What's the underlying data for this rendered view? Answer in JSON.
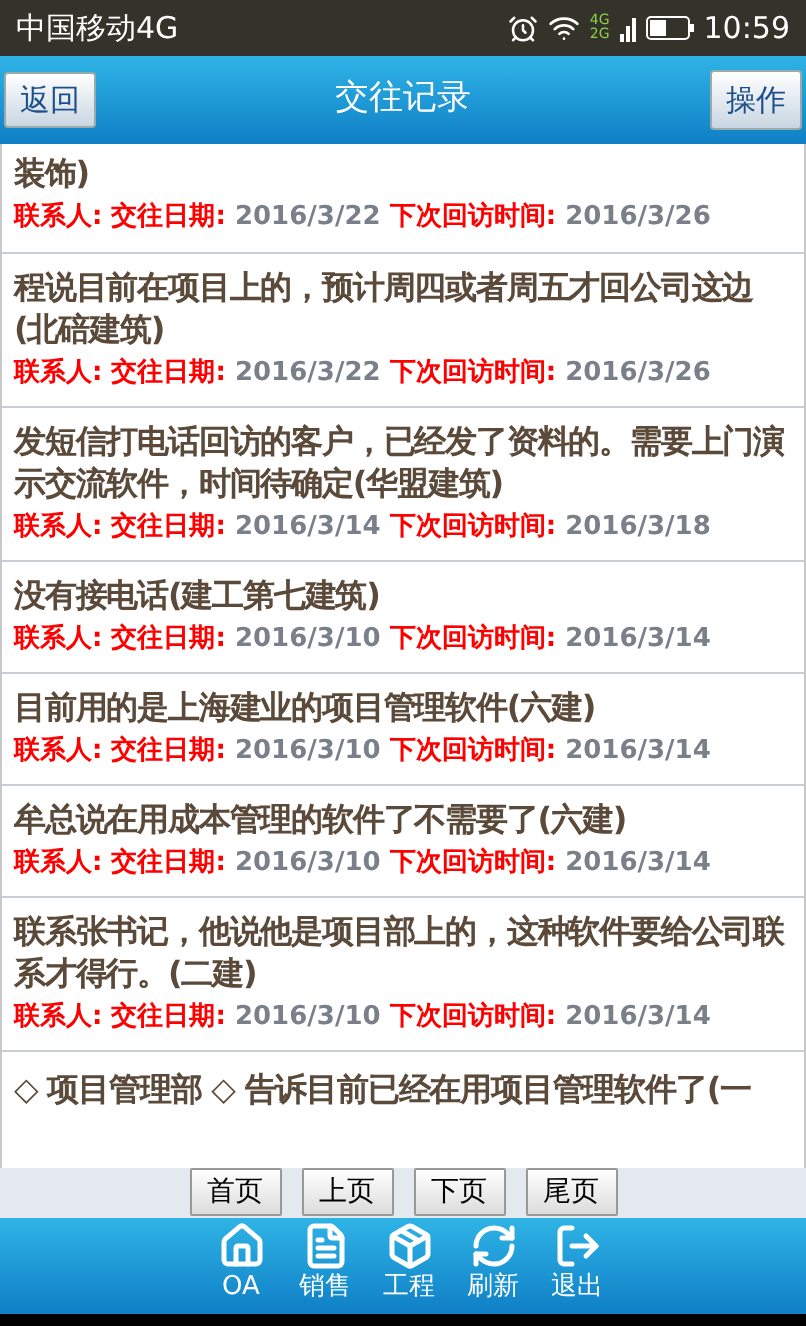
{
  "status_bar": {
    "carrier": "中国移动4G",
    "net_4g": "4G",
    "net_2g": "2G",
    "time": "10:59"
  },
  "header": {
    "back": "返回",
    "title": "交往记录",
    "action": "操作"
  },
  "records": [
    {
      "title": "装饰)",
      "contact_label": "联系人:",
      "date_label": "交往日期:",
      "date": "2016/3/22",
      "next_label": "下次回访时间:",
      "next_date": "2016/3/26"
    },
    {
      "title": "程说目前在项目上的，预计周四或者周五才回公司这边(北碚建筑)",
      "contact_label": "联系人:",
      "date_label": "交往日期:",
      "date": "2016/3/22",
      "next_label": "下次回访时间:",
      "next_date": "2016/3/26"
    },
    {
      "title": "发短信打电话回访的客户，已经发了资料的。需要上门演示交流软件，时间待确定(华盟建筑)",
      "contact_label": "联系人:",
      "date_label": "交往日期:",
      "date": "2016/3/14",
      "next_label": "下次回访时间:",
      "next_date": "2016/3/18"
    },
    {
      "title": "没有接电话(建工第七建筑)",
      "contact_label": "联系人:",
      "date_label": "交往日期:",
      "date": "2016/3/10",
      "next_label": "下次回访时间:",
      "next_date": "2016/3/14"
    },
    {
      "title": "目前用的是上海建业的项目管理软件(六建)",
      "contact_label": "联系人:",
      "date_label": "交往日期:",
      "date": "2016/3/10",
      "next_label": "下次回访时间:",
      "next_date": "2016/3/14"
    },
    {
      "title": "牟总说在用成本管理的软件了不需要了(六建)",
      "contact_label": "联系人:",
      "date_label": "交往日期:",
      "date": "2016/3/10",
      "next_label": "下次回访时间:",
      "next_date": "2016/3/14"
    },
    {
      "title": "联系张书记，他说他是项目部上的，这种软件要给公司联系才得行。(二建)",
      "contact_label": "联系人:",
      "date_label": "交往日期:",
      "date": "2016/3/10",
      "next_label": "下次回访时间:",
      "next_date": "2016/3/14"
    },
    {
      "title": "◇ 项目管理部 ◇ 告诉目前已经在用项目管理软件了(一"
    }
  ],
  "pager": [
    "首页",
    "上页",
    "下页",
    "尾页"
  ],
  "nav": [
    {
      "kind": "home",
      "label": "OA"
    },
    {
      "kind": "sales",
      "label": "销售"
    },
    {
      "kind": "project",
      "label": "工程"
    },
    {
      "kind": "refresh",
      "label": "刷新"
    },
    {
      "kind": "exit",
      "label": "退出"
    }
  ]
}
